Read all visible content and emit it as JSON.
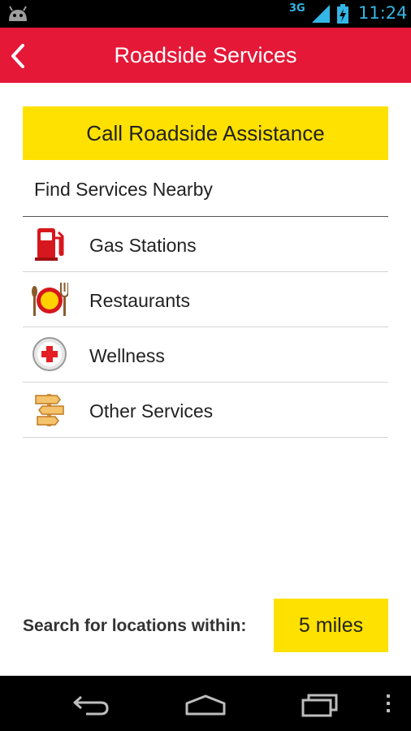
{
  "status_bar": {
    "network": "3G",
    "time": "11:24"
  },
  "app_bar": {
    "title": "Roadside Services"
  },
  "call_button": {
    "label": "Call Roadside Assistance"
  },
  "nearby": {
    "header": "Find Services Nearby",
    "items": [
      {
        "label": "Gas Stations",
        "icon": "gas-pump-icon"
      },
      {
        "label": "Restaurants",
        "icon": "plate-fork-icon"
      },
      {
        "label": "Wellness",
        "icon": "medical-cross-icon"
      },
      {
        "label": "Other Services",
        "icon": "signpost-icon"
      }
    ]
  },
  "search_radius": {
    "label": "Search for locations within:",
    "value": "5 miles"
  },
  "colors": {
    "app_bar": "#e51837",
    "accent_yellow": "#ffe100",
    "status_text": "#33b5e5"
  }
}
